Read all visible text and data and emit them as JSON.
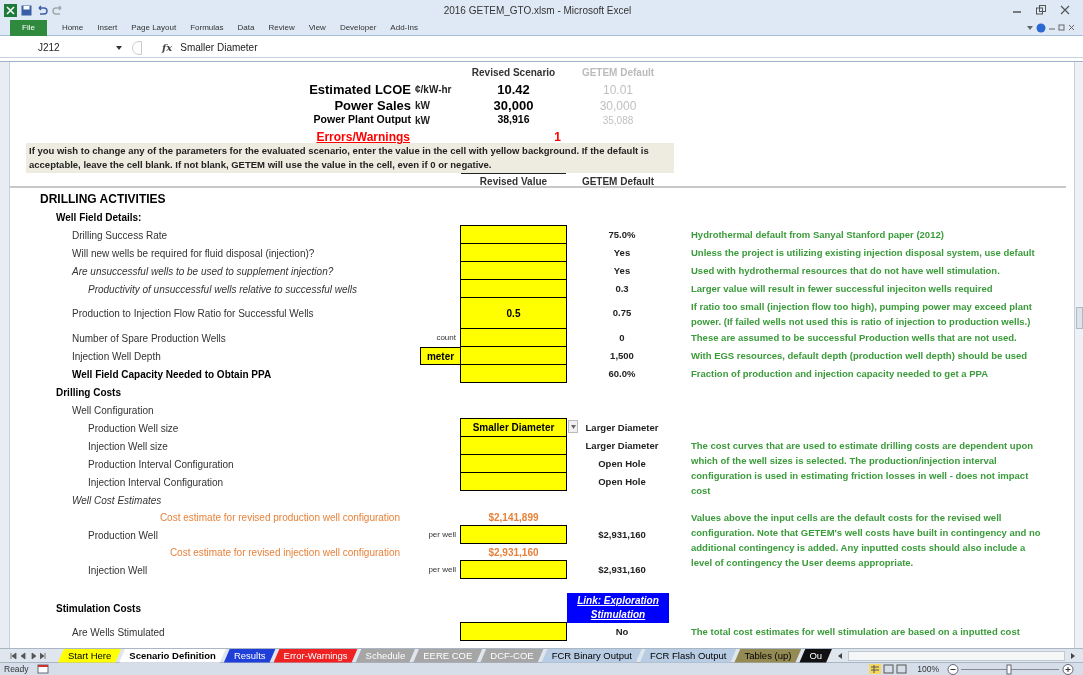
{
  "window": {
    "title": "2016 GETEM_GTO.xlsm - Microsoft Excel"
  },
  "ribbon_tabs": [
    {
      "label": "File",
      "selected": true
    },
    {
      "label": "Home",
      "selected": false
    },
    {
      "label": "Insert",
      "selected": false
    },
    {
      "label": "Page Layout",
      "selected": false
    },
    {
      "label": "Formulas",
      "selected": false
    },
    {
      "label": "Data",
      "selected": false
    },
    {
      "label": "Review",
      "selected": false
    },
    {
      "label": "View",
      "selected": false
    },
    {
      "label": "Developer",
      "selected": false
    },
    {
      "label": "Add-Ins",
      "selected": false
    }
  ],
  "formula_bar": {
    "cell": "J212",
    "function_label": "fx",
    "formula": "Smaller Diameter"
  },
  "summary": {
    "revised_header": "Revised Scenario",
    "default_header": "GETEM Default",
    "rows": [
      {
        "kind": "major",
        "label": "Estimated LCOE",
        "unit": "¢/kW-hr",
        "revised": "10.42",
        "default": "10.01"
      },
      {
        "kind": "major",
        "label": "Power Sales",
        "unit": "kW",
        "revised": "30,000",
        "default": "30,000"
      },
      {
        "kind": "minor",
        "label": "Power Plant Output",
        "unit": "kW",
        "revised": "38,916",
        "default": "35,088"
      }
    ],
    "errors": {
      "label": "Errors/Warnings",
      "value": "1"
    }
  },
  "instructions": "If you wish to change any of the parameters for the evaluated scenario, enter the value in the cell with yellow background. If the default is acceptable, leave the cell blank. If not blank, GETEM will use the value in the cell, even if 0 or negative.",
  "column_headers": {
    "revised": "Revised Value",
    "default": "GETEM Default"
  },
  "rows": [
    {
      "kind": "section",
      "label": "DRILLING ACTIVITIES",
      "children": [
        {
          "kind": "heading",
          "label": "Well Field Details:",
          "children": [
            {
              "kind": "item",
              "label": "Drilling Success Rate",
              "input": true,
              "default": "75.0%",
              "note": "Hydrothermal default from Sanyal Stanford paper (2012)"
            },
            {
              "kind": "item",
              "label": "Will new wells be required for fluid disposal (injection)?",
              "input": true,
              "default": "Yes",
              "note": "Unless the project is utilizing existing injection disposal system, use default"
            },
            {
              "kind": "italic",
              "label": "Are unsuccessful wells to be used to supplement injection?",
              "input": true,
              "default": "Yes",
              "note": "Used with hydrothermal resources that do not have well stimulation.",
              "children": [
                {
                  "kind": "italic",
                  "label": "Productivity of unsuccessful wells relative to successful wells",
                  "input": true,
                  "default": "0.3",
                  "note": "Larger value will result in fewer successful injeciton wells required"
                }
              ]
            },
            {
              "kind": "item",
              "label": "Production to Injection Flow Ratio for Successful Wells",
              "input": true,
              "revised": "0.5",
              "default": "0.75",
              "note": "If ratio too small (injection flow too high), pumping power may exceed plant power. (If failed wells not used this is ratio of injection to  production wells.)"
            },
            {
              "kind": "item",
              "label": "Number of Spare Production Wells",
              "unit": "count",
              "input": true,
              "default": "0",
              "note": "These are assumed to be successful Production wells  that are not used."
            },
            {
              "kind": "item",
              "label": "Injection Well Depth",
              "unit": "meter",
              "unit_highlight": true,
              "input": true,
              "default": "1,500",
              "note": "With EGS resources, default depth (production well depth) should be used"
            },
            {
              "kind": "strong",
              "label": "Well Field Capacity Needed to Obtain PPA",
              "input": true,
              "default": "60.0%",
              "note": "Fraction of production and injection capacity needed to get a PPA"
            }
          ]
        },
        {
          "kind": "heading",
          "label": "Drilling Costs",
          "children": [
            {
              "kind": "item",
              "label": "Well Configuration",
              "children": [
                {
                  "kind": "item",
                  "label": "Production Well size",
                  "input": true,
                  "dropdown": true,
                  "revised": "Smaller Diameter",
                  "default": "Larger Diameter"
                },
                {
                  "kind": "item",
                  "label": "Injection Well size",
                  "input": true,
                  "default": "Larger Diameter",
                  "note": "The cost curves that are used to estimate drilling costs are dependent upon which of the well sizes is selected. The production/injection interval configuration is used  in estimating friction losses in well - does not impact cost"
                },
                {
                  "kind": "item",
                  "label": "Production Interval Configuration",
                  "input": true,
                  "default": "Open Hole"
                },
                {
                  "kind": "item",
                  "label": "Injection Interval Configuration",
                  "input": true,
                  "default": "Open Hole"
                }
              ]
            },
            {
              "kind": "italic",
              "label": "Well Cost Estimates",
              "children": [
                {
                  "kind": "estimate",
                  "label": "Cost estimate  for revised production well configuration",
                  "revised": "$2,141,899",
                  "note": "Values above the input cells are the default costs for the revised well configuration. Note that GETEM's well costs have built in contingency and no additional contingency is added. Any inputted costs should also include a level of contingency the User deems appropriate."
                },
                {
                  "kind": "item",
                  "label": "Production Well",
                  "unit": "per well",
                  "input": true,
                  "default": "$2,931,160"
                },
                {
                  "kind": "estimate",
                  "label": "Cost estimate  for revised injection well configuration",
                  "revised": "$2,931,160"
                },
                {
                  "kind": "item",
                  "label": "Injection Well",
                  "unit": "per well",
                  "input": true,
                  "default": "$2,931,160"
                }
              ]
            }
          ]
        },
        {
          "kind": "heading",
          "label": "Stimulation Costs",
          "link": "Link: Exploration Stimulation",
          "children": [
            {
              "kind": "item",
              "label": "Are Wells Stimulated",
              "input": true,
              "default": "No",
              "note": "The total cost estimates for well stimulation are based on a inputted cost"
            }
          ]
        }
      ]
    }
  ],
  "sheet_tabs": [
    {
      "label": "Start Here",
      "selected": false,
      "color": "#ffff00"
    },
    {
      "label": "Scenario Definition",
      "selected": true,
      "color": "#ffffff"
    },
    {
      "label": "Results",
      "selected": false,
      "color": "#1f3fd8"
    },
    {
      "label": "Error-Warnings",
      "selected": false,
      "color": "#ee2222"
    },
    {
      "label": "Schedule",
      "selected": false,
      "color": "#a6a6a6"
    },
    {
      "label": "EERE COE",
      "selected": false,
      "color": "#a6a6a6"
    },
    {
      "label": "DCF-COE",
      "selected": false,
      "color": "#a6a6a6"
    },
    {
      "label": "FCR Binary Output",
      "selected": false,
      "color": "#b8cce4"
    },
    {
      "label": "FCR Flash Output",
      "selected": false,
      "color": "#b8cce4"
    },
    {
      "label": "Tables (up)",
      "selected": false,
      "color": "#948a54"
    },
    {
      "label": "Ou",
      "selected": false,
      "color": "#111111"
    }
  ],
  "status_bar": {
    "status": "Ready",
    "zoom": "100%"
  }
}
